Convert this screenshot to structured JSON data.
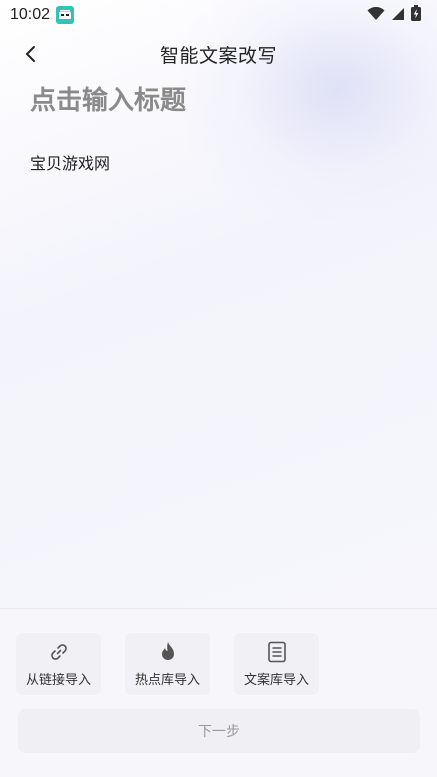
{
  "status_bar": {
    "time": "10:02",
    "icons": [
      "app-notification-icon",
      "wifi-icon",
      "signal-icon",
      "battery-charging-icon"
    ]
  },
  "header": {
    "back_icon": "chevron-left-icon",
    "title": "智能文案改写"
  },
  "editor": {
    "title_placeholder": "点击输入标题",
    "body_text": "宝贝游戏网"
  },
  "import_buttons": [
    {
      "label": "从链接导入",
      "icon": "link-icon"
    },
    {
      "label": "热点库导入",
      "icon": "flame-icon"
    },
    {
      "label": "文案库导入",
      "icon": "document-icon"
    }
  ],
  "next_button": {
    "label": "下一步"
  },
  "colors": {
    "accent_teal": "#2ec5b6",
    "title_gray": "#8a8a8a",
    "disabled_text": "#9a9a9a",
    "button_bg": "#efeff4"
  }
}
